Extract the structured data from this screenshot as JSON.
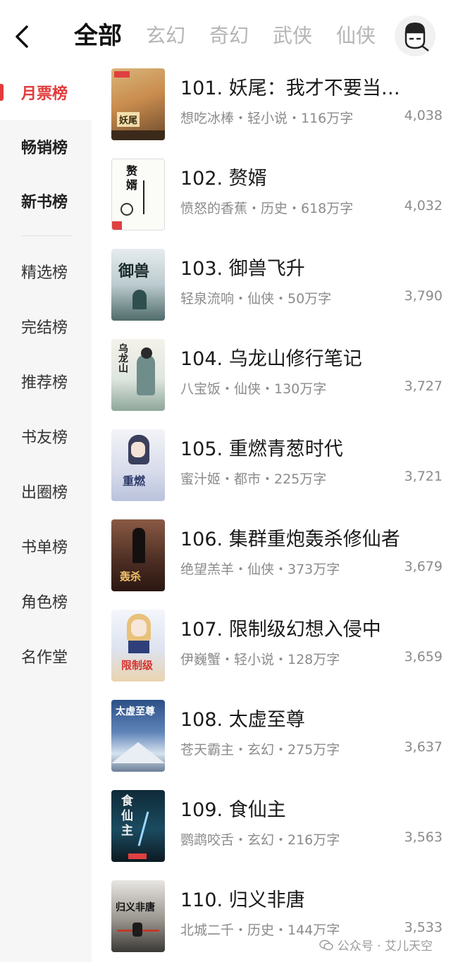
{
  "header": {
    "tabs": [
      {
        "label": "全部",
        "active": true
      },
      {
        "label": "玄幻",
        "active": false
      },
      {
        "label": "奇幻",
        "active": false
      },
      {
        "label": "武侠",
        "active": false
      },
      {
        "label": "仙侠",
        "active": false
      }
    ],
    "icons": {
      "back": "chevron-left-icon",
      "avatar": "user-avatar-icon"
    }
  },
  "sidebar": {
    "items": [
      {
        "label": "月票榜"
      },
      {
        "label": "畅销榜"
      },
      {
        "label": "新书榜"
      },
      {
        "label": "精选榜"
      },
      {
        "label": "完结榜"
      },
      {
        "label": "推荐榜"
      },
      {
        "label": "书友榜"
      },
      {
        "label": "出圈榜"
      },
      {
        "label": "书单榜"
      },
      {
        "label": "角色榜"
      },
      {
        "label": "名作堂"
      }
    ]
  },
  "books": [
    {
      "title": "101. 妖尾：我才不要当…",
      "author": "想吃冰棒",
      "genre": "轻小说",
      "words": "116万字",
      "meta": "想吃冰棒・轻小说・116万字",
      "count": "4,038",
      "cover_text": "妖尾"
    },
    {
      "title": "102. 赘婿",
      "author": "愤怒的香蕉",
      "genre": "历史",
      "words": "618万字",
      "meta": "愤怒的香蕉・历史・618万字",
      "count": "4,032",
      "cover_text": "赘婿"
    },
    {
      "title": "103. 御兽飞升",
      "author": "轻泉流响",
      "genre": "仙侠",
      "words": "50万字",
      "meta": "轻泉流响・仙侠・50万字",
      "count": "3,790",
      "cover_text": "御兽"
    },
    {
      "title": "104. 乌龙山修行笔记",
      "author": "八宝饭",
      "genre": "仙侠",
      "words": "130万字",
      "meta": "八宝饭・仙侠・130万字",
      "count": "3,727",
      "cover_text": "乌龙山"
    },
    {
      "title": "105. 重燃青葱时代",
      "author": "蜜汁姬",
      "genre": "都市",
      "words": "225万字",
      "meta": "蜜汁姬・都市・225万字",
      "count": "3,721",
      "cover_text": "重燃"
    },
    {
      "title": "106. 集群重炮轰杀修仙者",
      "author": "绝望羔羊",
      "genre": "仙侠",
      "words": "373万字",
      "meta": "绝望羔羊・仙侠・373万字",
      "count": "3,679",
      "cover_text": "轰杀"
    },
    {
      "title": "107. 限制级幻想入侵中",
      "author": "伊巍蟹",
      "genre": "轻小说",
      "words": "128万字",
      "meta": "伊巍蟹・轻小说・128万字",
      "count": "3,659",
      "cover_text": "限制级"
    },
    {
      "title": "108. 太虚至尊",
      "author": "苍天霸主",
      "genre": "玄幻",
      "words": "275万字",
      "meta": "苍天霸主・玄幻・275万字",
      "count": "3,637",
      "cover_text": "太虚至尊"
    },
    {
      "title": "109. 食仙主",
      "author": "鹦鹉咬舌",
      "genre": "玄幻",
      "words": "216万字",
      "meta": "鹦鹉咬舌・玄幻・216万字",
      "count": "3,563",
      "cover_text": "食仙主"
    },
    {
      "title": "110. 归义非唐",
      "author": "北城二千",
      "genre": "历史",
      "words": "144万字",
      "meta": "北城二千・历史・144万字",
      "count": "3,533",
      "cover_text": "归义非唐"
    }
  ],
  "watermark": {
    "label": "公众号 · 艾儿天空",
    "icon": "wechat-icon"
  },
  "colors": {
    "accent": "#e23b3b",
    "muted": "#8b8b8b",
    "sidebar_bg": "#f6f6f6"
  }
}
